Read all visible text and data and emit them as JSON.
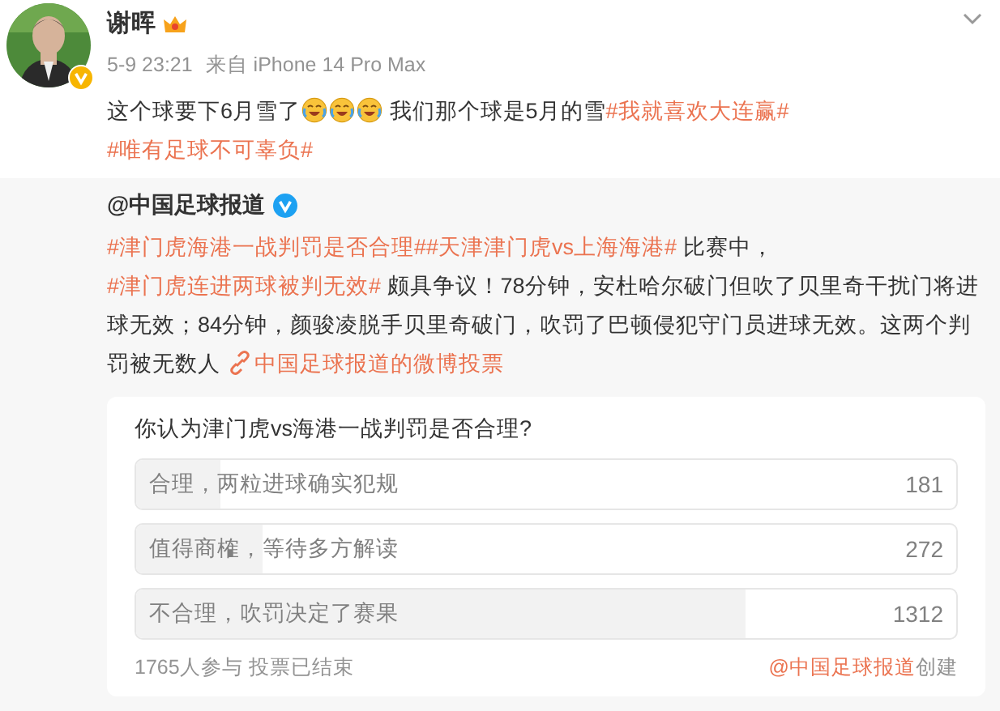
{
  "author": {
    "name": "谢晖",
    "verified": true
  },
  "meta": {
    "time": "5-9 23:21",
    "source": "来自 iPhone 14 Pro Max"
  },
  "post": {
    "segments": [
      {
        "kind": "text",
        "text": "这个球要下6月雪了"
      },
      {
        "kind": "emoji"
      },
      {
        "kind": "emoji"
      },
      {
        "kind": "emoji"
      },
      {
        "kind": "text",
        "text": " 我们那个球是5月的雪"
      },
      {
        "kind": "topic",
        "text": "#我就喜欢大连赢#"
      },
      {
        "kind": "gap"
      },
      {
        "kind": "topic",
        "text": "#唯有足球不可辜负#"
      }
    ]
  },
  "repost": {
    "author": "@中国足球报道",
    "verified": true,
    "segments": [
      {
        "kind": "topic",
        "text": "#津门虎海港一战判罚是否合理#"
      },
      {
        "kind": "topic",
        "text": "#天津津门虎vs上海海港#"
      },
      {
        "kind": "text",
        "text": " 比赛中，"
      },
      {
        "kind": "topic",
        "text": "#津门虎连进两球被判无效#"
      },
      {
        "kind": "text",
        "text": " 颇具争议！78分钟，安杜哈尔破门但吹了贝里奇干扰门将进球无效；84分钟，颜骏凌脱手贝里奇破门，吹罚了巴顿侵犯守门员进球无效。这两个判罚被无数人 "
      },
      {
        "kind": "link",
        "text": "中国足球报道的微博投票"
      }
    ]
  },
  "poll": {
    "question": "你认为津门虎vs海港一战判罚是否合理?",
    "options": [
      {
        "label": "合理，两粒进球确实犯规",
        "count": "181",
        "level": 0.103
      },
      {
        "label": "值得商榷，等待多方解读",
        "count": "272",
        "level": 0.154
      },
      {
        "label": "不合理，吹罚决定了赛果",
        "count": "1312",
        "level": 0.743
      }
    ],
    "footer": "1765人参与 投票已结束",
    "creator": "@中国足球报道",
    "creator_suffix": "创建"
  }
}
